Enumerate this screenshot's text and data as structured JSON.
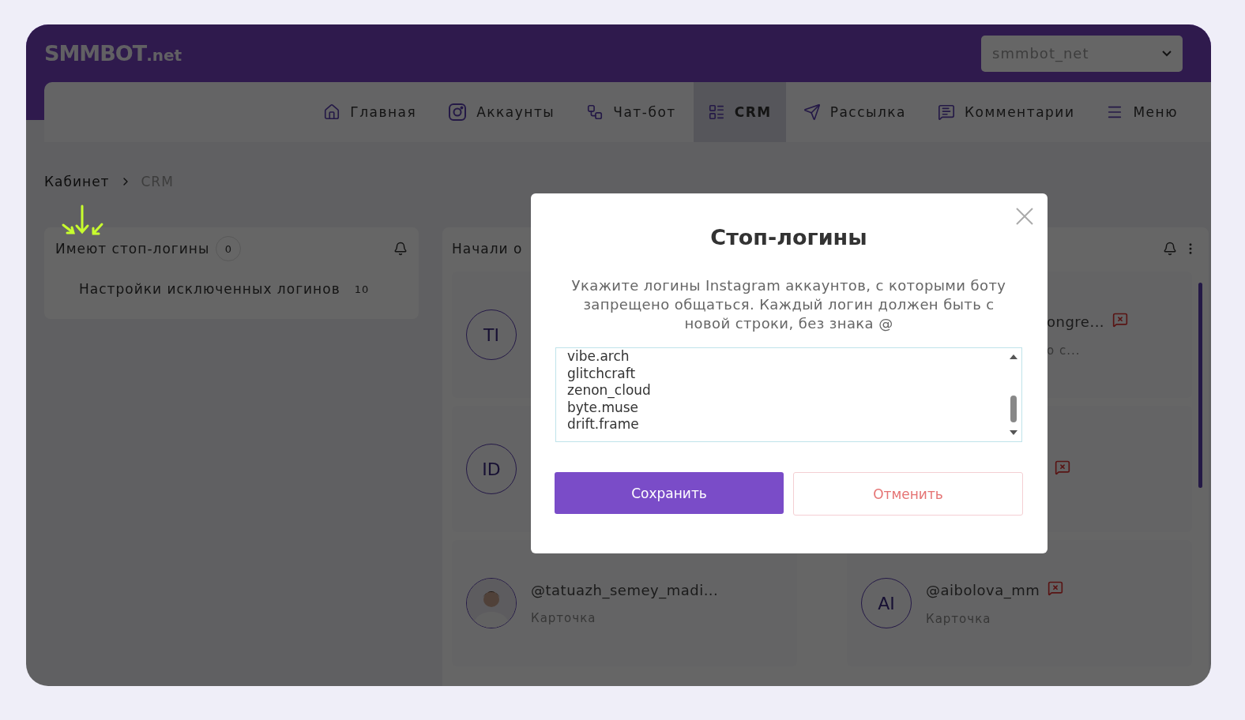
{
  "logo": {
    "main": "SMMBOT",
    "suffix": ".net"
  },
  "account_select": {
    "value": "smmbot_net"
  },
  "nav": [
    {
      "label": "Главная",
      "selected": false
    },
    {
      "label": "Аккаунты",
      "selected": false
    },
    {
      "label": "Чат-бот",
      "selected": false
    },
    {
      "label": "CRM",
      "selected": true
    },
    {
      "label": "Рассылка",
      "selected": false
    },
    {
      "label": "Комментарии",
      "selected": false
    },
    {
      "label": "Меню",
      "selected": false
    }
  ],
  "breadcrumb": [
    {
      "label": "Кабинет",
      "current": false
    },
    {
      "label": "CRM",
      "current": true
    }
  ],
  "stop_panel": {
    "title": "Имеют стоп-логины",
    "count": "0",
    "item": {
      "label": "Настройки исключенных логинов",
      "count": "10"
    }
  },
  "started_panel": {
    "title": "Начали о",
    "cards": [
      {
        "kind": "left",
        "avatar": "TI"
      },
      {
        "kind": "partial",
        "name": "ongre...",
        "flag": true,
        "subtitle": "о с..."
      },
      {
        "kind": "left",
        "avatar": "ID"
      },
      {
        "kind": "partial",
        "flag": true
      },
      {
        "name": "@tatuazh_semey_madi...",
        "flag": false,
        "subtitle": "Карточка"
      },
      {
        "kind": "full",
        "avatar": "AI",
        "name": "@aibolova_mm",
        "flag": true,
        "subtitle": "Карточка"
      }
    ]
  },
  "modal": {
    "title": "Стоп-логины",
    "description": "Укажите логины Instagram аккаунтов, с которыми боту запрещено общаться. Каждый логин должен быть с новой строки, без знака @",
    "logins": [
      "vibe.arch",
      "glitchcraft",
      "zenon_cloud",
      "byte.muse",
      "drift.frame"
    ],
    "save": "Сохранить",
    "cancel": "Отменить"
  }
}
